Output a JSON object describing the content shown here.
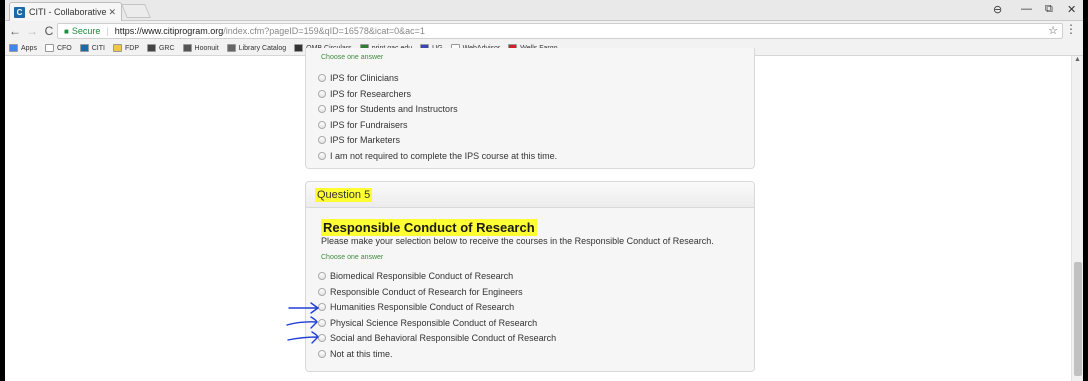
{
  "browser": {
    "tab_title": "CITI - Collaborative Instit",
    "tab_favicon": "C",
    "secure_label": "Secure",
    "url_host": "https://www.citiprogram.org",
    "url_path": "/index.cfm?pageID=159&qID=16578&icat=0&ac=1",
    "window_controls": [
      "⊖",
      "—",
      "⧉",
      "✕"
    ]
  },
  "bookmarks": [
    {
      "label": "Apps",
      "icon": "apps-grid-icon",
      "color": "#4285f4"
    },
    {
      "label": "CFO",
      "icon": "page-icon",
      "color": "#ffffff"
    },
    {
      "label": "CITI",
      "icon": "citi-icon",
      "color": "#1a6aa8"
    },
    {
      "label": "FDP",
      "icon": "folder-icon",
      "color": "#f4c542"
    },
    {
      "label": "GRC",
      "icon": "grc-icon",
      "color": "#444444"
    },
    {
      "label": "Hoonuit",
      "icon": "infinity-icon",
      "color": "#555555"
    },
    {
      "label": "Library Catalog",
      "icon": "library-icon",
      "color": "#666666"
    },
    {
      "label": "OMB Circulars",
      "icon": "omb-icon",
      "color": "#333333"
    },
    {
      "label": "print.gac.edu",
      "icon": "print-icon",
      "color": "#2e7d32"
    },
    {
      "label": "UG",
      "icon": "ug-icon",
      "color": "#3949ab"
    },
    {
      "label": "WebAdvisor",
      "icon": "page-icon",
      "color": "#ffffff"
    },
    {
      "label": "Wells Fargo",
      "icon": "wells-fargo-icon",
      "color": "#d71e28"
    }
  ],
  "prev_question": {
    "choose_label": "Choose one answer",
    "options": [
      "IPS for Clinicians",
      "IPS for Researchers",
      "IPS for Students and Instructors",
      "IPS for Fundraisers",
      "IPS for Marketers",
      "I am not required to complete the IPS course at this time."
    ]
  },
  "question5": {
    "header": "Question 5",
    "title": "Responsible Conduct of Research",
    "description": "Please make your selection below to receive the courses in the Responsible Conduct of Research.",
    "choose_label": "Choose one answer",
    "options": [
      "Biomedical Responsible Conduct of Research",
      "Responsible Conduct of Research for Engineers",
      "Humanities Responsible Conduct of Research",
      "Physical Science Responsible Conduct of Research",
      "Social and Behavioral Responsible Conduct of Research",
      "Not at this time."
    ]
  },
  "colors": {
    "highlight": "#ffff33",
    "annotation_ink": "#1f3fd6",
    "choose_text": "#3e8e3e"
  }
}
